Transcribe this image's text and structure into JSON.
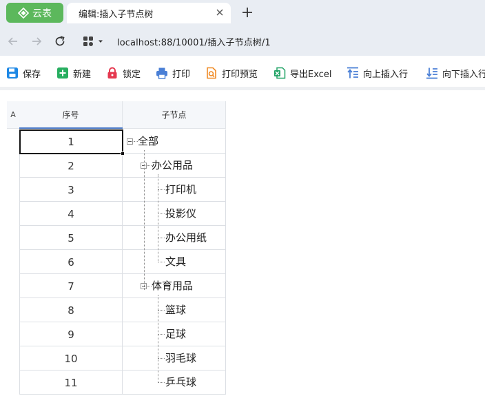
{
  "browser": {
    "brand_label": "云表",
    "tab_title": "编辑:插入子节点树",
    "url": "localhost:88/10001/插入子节点树/1"
  },
  "toolbar": {
    "items": [
      {
        "label": "保存",
        "icon": "save-icon",
        "color": "#1e88e5"
      },
      {
        "label": "新建",
        "icon": "new-icon",
        "color": "#27ae60"
      },
      {
        "label": "锁定",
        "icon": "lock-icon",
        "color": "#e53950"
      },
      {
        "label": "打印",
        "icon": "printer-icon",
        "color": "#4a7fd6"
      },
      {
        "label": "打印预览",
        "icon": "print-preview-icon",
        "color": "#f08a24"
      },
      {
        "label": "导出Excel",
        "icon": "excel-icon",
        "color": "#21a366"
      },
      {
        "label": "向上插入行",
        "icon": "insert-row-above-icon",
        "color": "#4a7fd6"
      },
      {
        "label": "向下插入行",
        "icon": "insert-row-below-icon",
        "color": "#4a7fd6"
      }
    ]
  },
  "grid": {
    "corner_label": "A",
    "columns": [
      "序号",
      "子节点"
    ],
    "rows": [
      {
        "no": "1",
        "node": "全部",
        "level": 0,
        "expandable": true
      },
      {
        "no": "2",
        "node": "办公用品",
        "level": 1,
        "expandable": true
      },
      {
        "no": "3",
        "node": "打印机",
        "level": 2,
        "expandable": false
      },
      {
        "no": "4",
        "node": "投影仪",
        "level": 2,
        "expandable": false
      },
      {
        "no": "5",
        "node": "办公用纸",
        "level": 2,
        "expandable": false
      },
      {
        "no": "6",
        "node": "文具",
        "level": 2,
        "expandable": false
      },
      {
        "no": "7",
        "node": "体育用品",
        "level": 1,
        "expandable": true
      },
      {
        "no": "8",
        "node": "篮球",
        "level": 2,
        "expandable": false
      },
      {
        "no": "9",
        "node": "足球",
        "level": 2,
        "expandable": false
      },
      {
        "no": "10",
        "node": "羽毛球",
        "level": 2,
        "expandable": false
      },
      {
        "no": "11",
        "node": "乒乓球",
        "level": 2,
        "expandable": false
      }
    ]
  }
}
